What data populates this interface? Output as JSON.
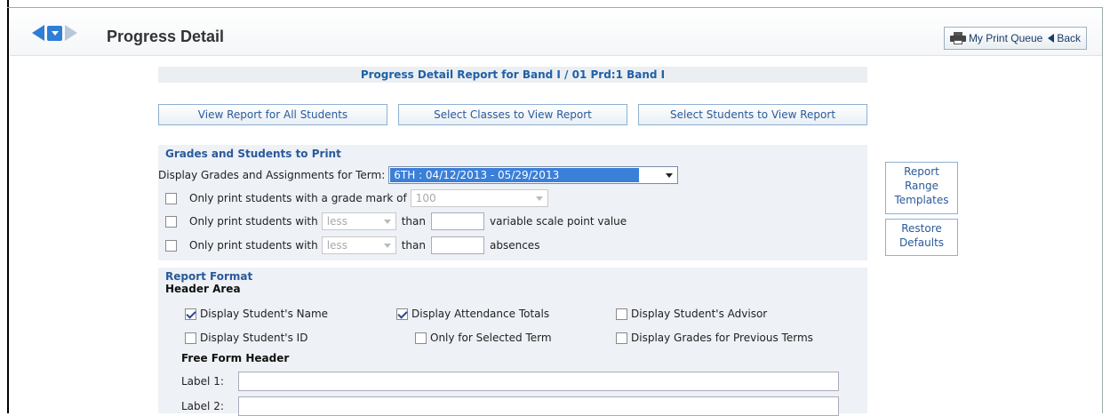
{
  "page": {
    "title": "Progress Detail"
  },
  "toolbar": {
    "print_queue_label": "My Print Queue",
    "back_label": "Back"
  },
  "report": {
    "header": "Progress Detail Report for Band I / 01 Prd:1 Band I"
  },
  "view_buttons": {
    "all_students": "View Report for All Students",
    "select_classes": "Select Classes to View Report",
    "select_students": "Select Students to View Report"
  },
  "grades_section": {
    "title": "Grades and Students to Print",
    "term_label": "Display Grades and Assignments for Term:",
    "term_value": "6TH : 04/12/2013 - 05/29/2013",
    "grade_mark_label": "Only print students with a grade mark of",
    "grade_mark_value": "100",
    "scale_label_pre": "Only print students with",
    "scale_compare": "less",
    "scale_than": "than",
    "scale_label_post": "variable scale point value",
    "absence_label_pre": "Only print students with",
    "absence_compare": "less",
    "absence_than": "than",
    "absence_label_post": "absences"
  },
  "side_buttons": {
    "report_range_templates": [
      "Report",
      "Range",
      "Templates"
    ],
    "restore_defaults": [
      "Restore",
      "Defaults"
    ]
  },
  "format_section": {
    "title": "Report Format",
    "header_area": "Header Area",
    "display_student_name": {
      "label": "Display Student's Name",
      "checked": true
    },
    "display_attendance_totals": {
      "label": "Display Attendance Totals",
      "checked": true
    },
    "display_student_advisor": {
      "label": "Display Student's Advisor",
      "checked": false
    },
    "display_student_id": {
      "label": "Display Student's ID",
      "checked": false
    },
    "only_selected_term": {
      "label": "Only for Selected Term",
      "checked": false
    },
    "display_previous_terms": {
      "label": "Display Grades for Previous Terms",
      "checked": false
    },
    "free_form_header": "Free Form Header",
    "label1": "Label 1:",
    "label2": "Label 2:"
  },
  "colors": {
    "accent": "#2a5a9a",
    "selection": "#3a7fd8",
    "section_bg": "#eef1f6"
  }
}
